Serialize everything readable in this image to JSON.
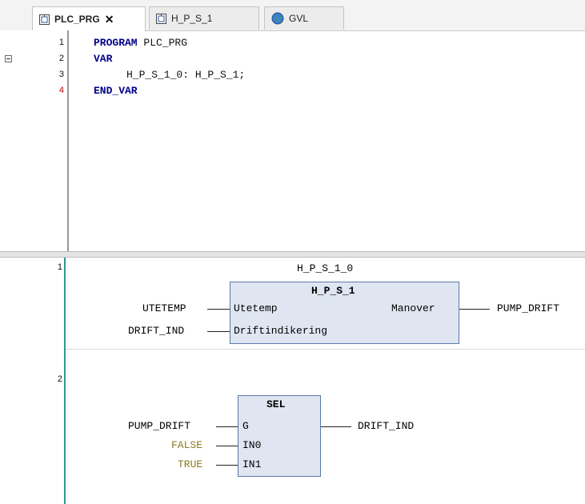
{
  "tabs": [
    {
      "label": "PLC_PRG",
      "close": "✕",
      "icon": "pou-icon"
    },
    {
      "label": "H_P_S_1",
      "icon": "pou-icon"
    },
    {
      "label": "GVL",
      "icon": "globe-icon"
    }
  ],
  "declaration": {
    "lines": [
      {
        "num": "1",
        "kw": "PROGRAM",
        "rest": " PLC_PRG"
      },
      {
        "num": "2",
        "kw": "VAR",
        "rest": ""
      },
      {
        "num": "3",
        "kw": "",
        "rest": "H_P_S_1_0: H_P_S_1;"
      },
      {
        "num": "4",
        "kw": "END_VAR",
        "rest": ""
      }
    ]
  },
  "networks": [
    {
      "num": "1",
      "instance": "H_P_S_1_0",
      "block": "H_P_S_1",
      "inputs": [
        {
          "var": "UTETEMP",
          "pin": "Utetemp"
        },
        {
          "var": "DRIFT_IND",
          "pin": "Driftindikering"
        }
      ],
      "output": {
        "pin": "Manover",
        "var": "PUMP_DRIFT"
      }
    },
    {
      "num": "2",
      "block": "SEL",
      "inputs": [
        {
          "var": "PUMP_DRIFT",
          "pin": "G"
        },
        {
          "var": "FALSE",
          "pin": "IN0"
        },
        {
          "var": "TRUE",
          "pin": "IN1"
        }
      ],
      "output": {
        "pin": "",
        "var": "DRIFT_IND"
      }
    }
  ]
}
